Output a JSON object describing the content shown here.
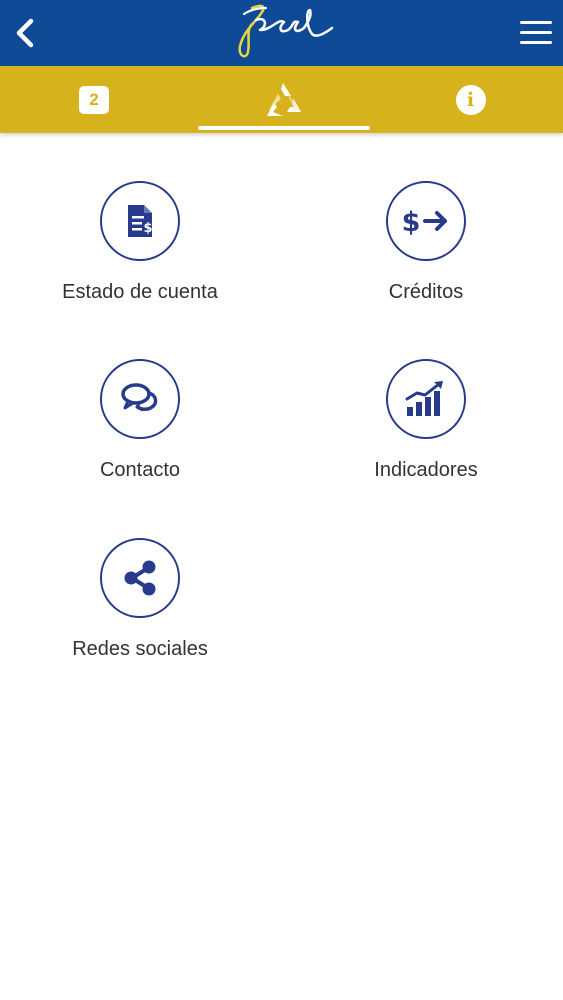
{
  "header": {
    "logo_text": "Fecel",
    "back_icon": "chevron-left-icon",
    "menu_icon": "hamburger-menu-icon"
  },
  "tabs": {
    "badge_count": "2",
    "home_icon": "triangle-logo-icon",
    "info_icon": "info-icon"
  },
  "menu": {
    "estado": "Estado de cuenta",
    "creditos": "Créditos",
    "contacto": "Contacto",
    "indicadores": "Indicadores",
    "redes": "Redes sociales"
  },
  "colors": {
    "primary_blue": "#0f4a96",
    "accent_gold": "#d6b21c",
    "icon_navy": "#283a8c"
  }
}
